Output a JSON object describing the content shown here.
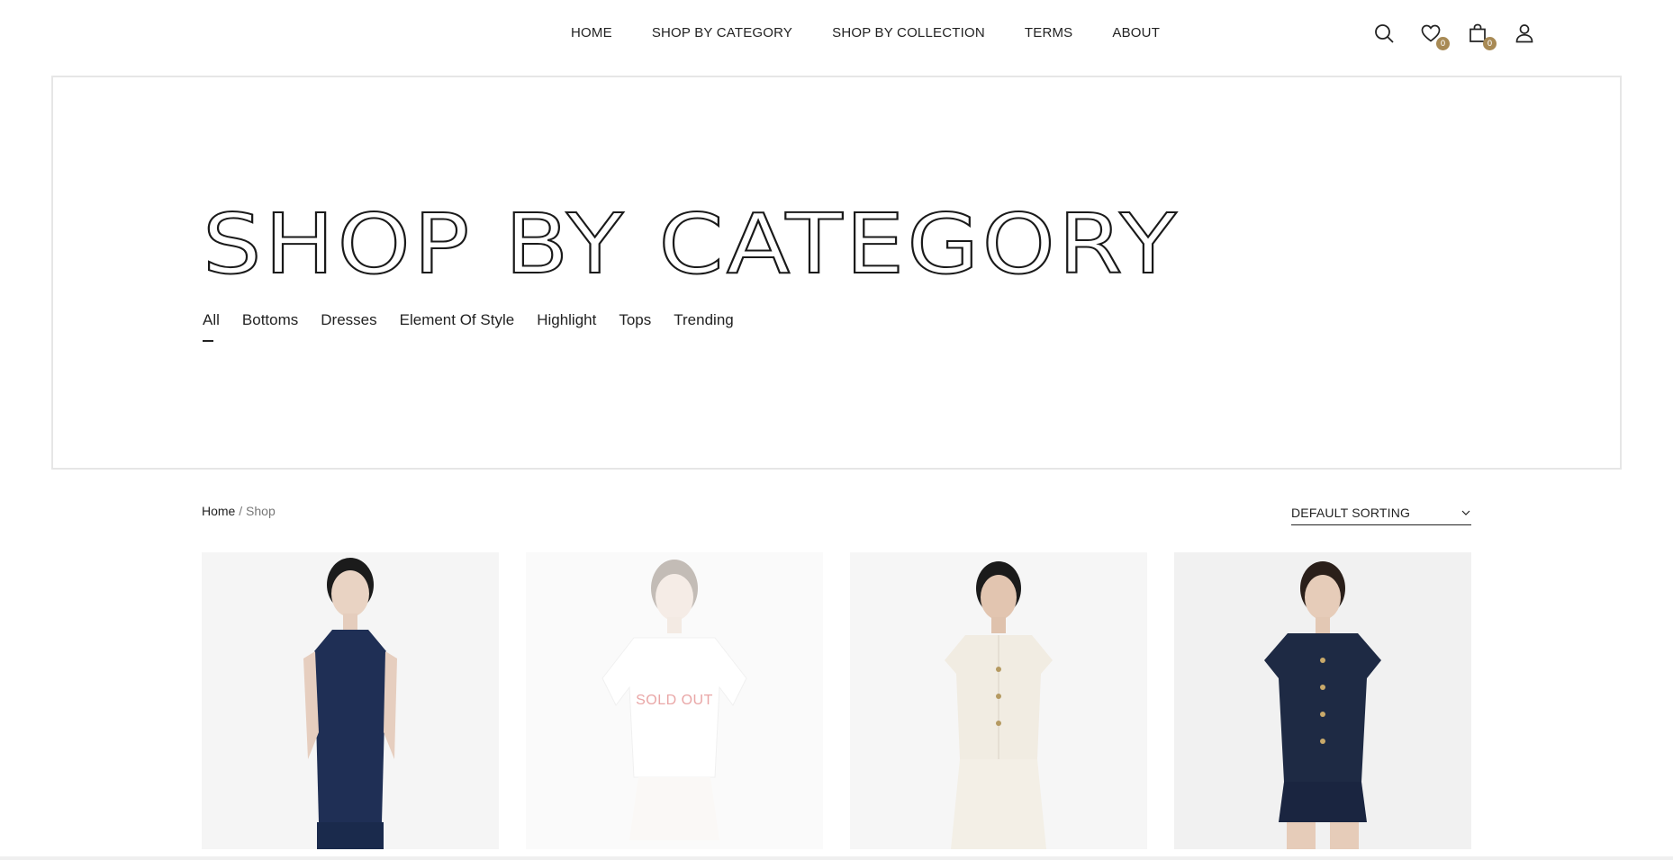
{
  "nav": {
    "items": [
      "HOME",
      "SHOP BY CATEGORY",
      "SHOP BY COLLECTION",
      "TERMS",
      "ABOUT"
    ]
  },
  "header_icons": {
    "search": "search-icon",
    "wishlist": "heart-icon",
    "wishlist_count": "0",
    "cart": "shopping-bag-icon",
    "cart_count": "0",
    "account": "user-icon",
    "badge_color": "#a88a55"
  },
  "hero": {
    "title": "SHOP BY CATEGORY",
    "tabs": [
      "All",
      "Bottoms",
      "Dresses",
      "Element Of Style",
      "Highlight",
      "Tops",
      "Trending"
    ],
    "active_tab": "All"
  },
  "breadcrumb": {
    "home": "Home",
    "separator": " / ",
    "current": "Shop"
  },
  "sort": {
    "selected": "DEFAULT SORTING"
  },
  "products": [
    {
      "name": "product-denim-sleeveless-top",
      "outfit_color": "#1f2f55",
      "sold_out": false
    },
    {
      "name": "product-white-lace-blouse",
      "outfit_color": "#f7f7f7",
      "sold_out": true,
      "sold_out_label": "SOLD OUT"
    },
    {
      "name": "product-cream-vest-top",
      "outfit_color": "#f1ece2",
      "sold_out": false
    },
    {
      "name": "product-denim-shirt-dress",
      "outfit_color": "#1e2a44",
      "sold_out": false
    }
  ]
}
